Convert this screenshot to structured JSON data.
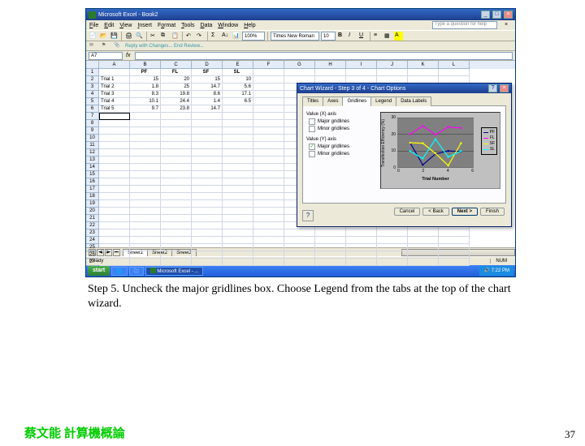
{
  "app": {
    "title": "Microsoft Excel - Book2",
    "help_placeholder": "Type a question for help"
  },
  "menu": [
    "File",
    "Edit",
    "View",
    "Insert",
    "Format",
    "Tools",
    "Data",
    "Window",
    "Help"
  ],
  "toolbar": {
    "zoom": "100%",
    "font_name": "Times New Roman",
    "font_size": "10"
  },
  "reply_bar": {
    "text": "Reply with Changes...  End Review..."
  },
  "columns": [
    "A",
    "B",
    "C",
    "D",
    "E",
    "F",
    "G",
    "H",
    "I",
    "J",
    "K",
    "L"
  ],
  "data_headers": [
    "",
    "PF",
    "FL",
    "SF",
    "SL"
  ],
  "data_rows": [
    [
      "Trial 1",
      "15",
      "20",
      "15",
      "10"
    ],
    [
      "Trial 2",
      "1.8",
      "25",
      "14.7",
      "5.6"
    ],
    [
      "Trial 3",
      "8.3",
      "19.8",
      "8.6",
      "17.1"
    ],
    [
      "Trial 4",
      "10.1",
      "24.4",
      "1.4",
      "6.5"
    ],
    [
      "Trial 5",
      "9.7",
      "23.8",
      "14.7",
      ""
    ]
  ],
  "row_count_total": 27,
  "selected_cell": "A7",
  "sheets": {
    "tabs": [
      "Sheet1",
      "Sheet2",
      "Sheet3"
    ],
    "active": "Sheet1"
  },
  "status": {
    "left": "Ready",
    "num": "NUM"
  },
  "taskbar": {
    "start": "start",
    "items": [
      "",
      "",
      "Microsoft Excel - ..."
    ],
    "time": "7:22 PM"
  },
  "wizard": {
    "title": "Chart Wizard - Step 3 of 4 - Chart Options",
    "tabs": [
      "Titles",
      "Axes",
      "Gridlines",
      "Legend",
      "Data Labels"
    ],
    "active_tab": "Gridlines",
    "groups": [
      {
        "title": "Value (X) axis",
        "options": [
          {
            "label": "Major gridlines",
            "checked": false
          },
          {
            "label": "Minor gridlines",
            "checked": false
          }
        ]
      },
      {
        "title": "Value (Y) axis",
        "options": [
          {
            "label": "Major gridlines",
            "checked": true
          },
          {
            "label": "Minor gridlines",
            "checked": false
          }
        ]
      }
    ],
    "buttons": {
      "cancel": "Cancel",
      "back": "< Back",
      "next": "Next >",
      "finish": "Finish"
    },
    "help": "?"
  },
  "chart_data": {
    "type": "line",
    "x": [
      1,
      2,
      3,
      4,
      5
    ],
    "series": [
      {
        "name": "PF",
        "values": [
          15,
          1.8,
          8.3,
          10.1,
          9.7
        ]
      },
      {
        "name": "FL",
        "values": [
          20,
          25,
          19.8,
          24.4,
          23.8
        ]
      },
      {
        "name": "SF",
        "values": [
          15,
          14.7,
          8.6,
          1.4,
          14.7
        ]
      },
      {
        "name": "SL",
        "values": [
          10,
          5.6,
          17.1,
          6.5,
          10
        ]
      }
    ],
    "ylabel": "Transfection Efficiency (%)",
    "xlabel": "Trial Number",
    "ylim": [
      0,
      30
    ],
    "xlim": [
      0,
      6
    ],
    "xticks": [
      0,
      2,
      4,
      6
    ],
    "yticks": [
      0,
      10,
      20,
      30
    ],
    "legend": [
      "PF",
      "FL",
      "SF",
      "SL"
    ]
  },
  "caption": "Step 5. Uncheck the major gridlines box.  Choose Legend from the tabs at the top of the chart wizard.",
  "footer": "蔡文能 計算機概論",
  "page": "37"
}
